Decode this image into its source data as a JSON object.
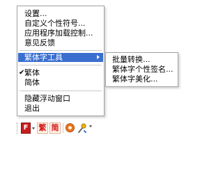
{
  "context_menu": {
    "items": [
      {
        "label": "设置..."
      },
      {
        "label": "自定义个性符号..."
      },
      {
        "label": "应用程序加载控制..."
      },
      {
        "label": "意见反馈"
      },
      {
        "label": "繁体字工具",
        "highlighted": true,
        "has_submenu": true
      },
      {
        "label": "繁体",
        "checked": true
      },
      {
        "label": "简体"
      },
      {
        "label": "隐藏浮动窗口"
      },
      {
        "label": "退出"
      }
    ],
    "checkmark": "✔"
  },
  "submenu": {
    "items": [
      {
        "label": "批量转换..."
      },
      {
        "label": "繁体字个性签名..."
      },
      {
        "label": "繁体字美化..."
      }
    ]
  },
  "toolbar": {
    "logo_glyph": "F",
    "traditional_label": "繁",
    "simplified_label": "简",
    "icons": [
      "dropdown-arrow-icon",
      "settings-circle-icon",
      "tool-icon",
      "more-icon"
    ]
  },
  "colors": {
    "highlight": "#3a6fd0",
    "logo_red": "#c81e1e",
    "toolbar_text_red": "#d41c1c",
    "circle_orange": "#e8741c"
  }
}
